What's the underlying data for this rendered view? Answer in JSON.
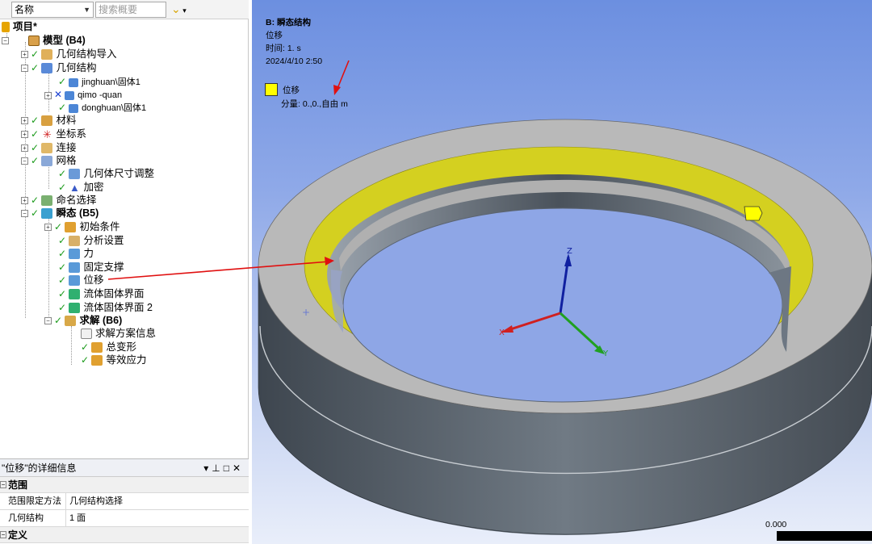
{
  "filter": {
    "name_value": "名称",
    "search_placeholder": "搜索概要"
  },
  "tree": {
    "root": "项目*",
    "model": "模型 (B4)",
    "geom_import": "几何结构导入",
    "geometry": "几何结构",
    "body1": "jinghuan\\固体1",
    "body2": "qimo -quan",
    "body3": "donghuan\\固体1",
    "materials": "材料",
    "coords": "坐标系",
    "connections": "连接",
    "mesh": "网格",
    "sizing": "几何体尺寸调整",
    "refine": "加密",
    "named_sel": "命名选择",
    "transient": "瞬态 (B5)",
    "init_cond": "初始条件",
    "analysis_settings": "分析设置",
    "force": "力",
    "fixed_support": "固定支撑",
    "displacement": "位移",
    "fsi1": "流体固体界面",
    "fsi2": "流体固体界面 2",
    "solution": "求解 (B6)",
    "solution_info": "求解方案信息",
    "total_def": "总变形",
    "equiv_stress": "等效应力"
  },
  "details": {
    "title": "\"位移\"的详细信息",
    "section_scope": "范围",
    "scoping_method_label": "范围限定方法",
    "scoping_method_value": "几何结构选择",
    "geometry_label": "几何结构",
    "geometry_value": "1 面",
    "section_definition": "定义"
  },
  "viewport": {
    "title": "B: 瞬态结构",
    "subtitle": "位移",
    "time": "时间: 1. s",
    "date": "2024/4/10 2:50",
    "legend_label": "位移",
    "component": "分量: 0.,0.,自由 m",
    "axis_x": "X",
    "axis_y": "Y",
    "axis_z": "Z",
    "scale_label": "0.000"
  },
  "colors": {
    "highlight": "#d4d020",
    "ring_top": "#b9b9b9",
    "ring_side": "#5d6670",
    "annotation": "#e01010"
  }
}
